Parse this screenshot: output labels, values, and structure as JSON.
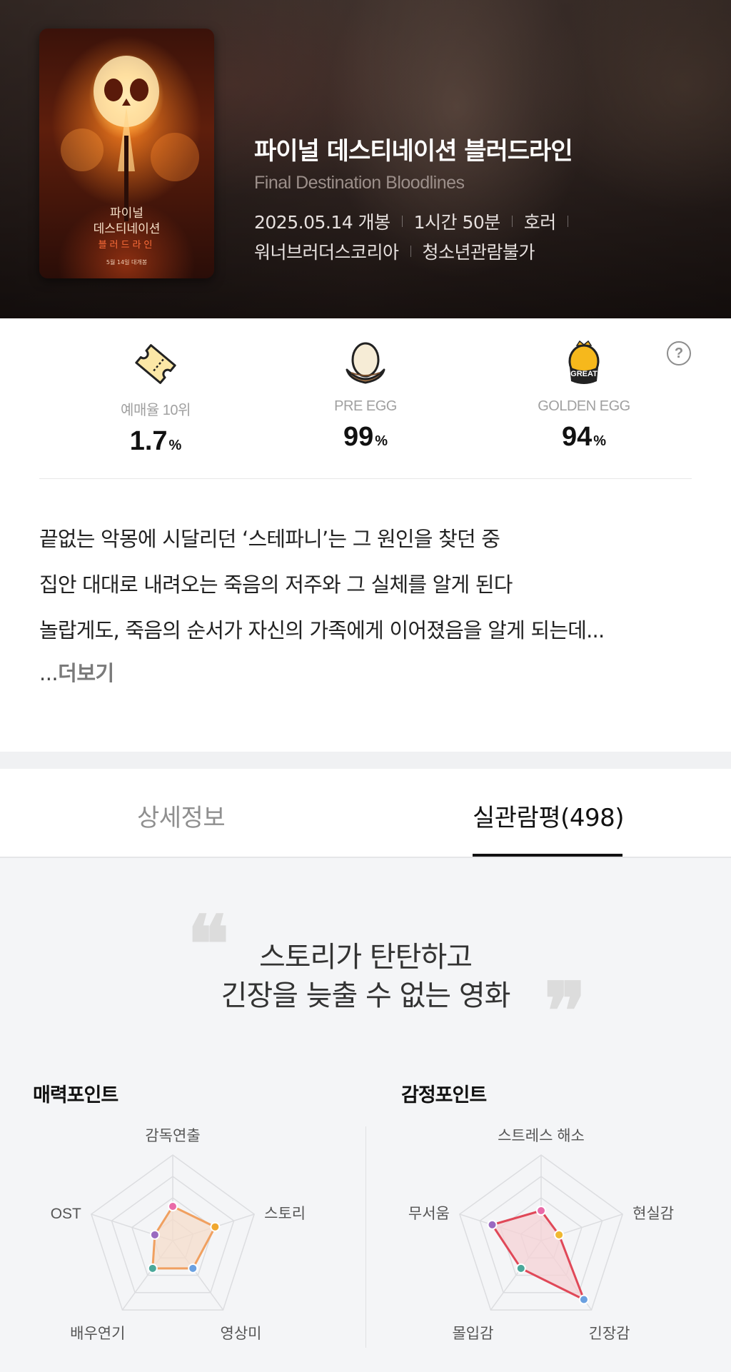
{
  "movie": {
    "title": "파이널 데스티네이션 블러드라인",
    "original_title": "Final Destination Bloodlines",
    "release": "2025.05.14 개봉",
    "runtime": "1시간 50분",
    "genre": "호러",
    "distributor": "워너브러더스코리아",
    "rating": "청소년관람불가",
    "poster": {
      "title_line1": "파이널",
      "title_line2": "데스티네이션",
      "title_line3": "블러드라인",
      "date_text": "5월 14일 대개봉"
    }
  },
  "stats": {
    "booking": {
      "label": "예매율 10위",
      "value": "1.7",
      "unit": "%",
      "icon": "ticket-icon"
    },
    "pre_egg": {
      "label": "PRE EGG",
      "value": "99",
      "unit": "%",
      "icon": "egg-nest-icon"
    },
    "golden_egg": {
      "label": "GOLDEN EGG",
      "value": "94",
      "unit": "%",
      "icon": "golden-egg-great-icon",
      "badge": "GREAT"
    },
    "help": "?"
  },
  "synopsis": {
    "lines": [
      "끝없는 악몽에 시달리던 ‘스테파니’는 그 원인을 찾던 중",
      "집안 대대로 내려오는 죽음의 저주와 그 실체를 알게 된다",
      "놀랍게도, 죽음의 순서가 자신의 가족에게 이어졌음을 알게 되는데..."
    ],
    "more_prefix": "...",
    "more_label": "더보기"
  },
  "tabs": {
    "detail": "상세정보",
    "reviews": "실관람평(498)",
    "active": "reviews"
  },
  "review": {
    "headline_line1": "스토리가 탄탄하고",
    "headline_line2": "긴장을 늦출 수 없는 영화",
    "quote_open": "❝",
    "quote_close": "❞"
  },
  "chart_data": [
    {
      "type": "radar",
      "title": "매력포인트",
      "axes": [
        "감독연출",
        "스토리",
        "영상미",
        "배우연기",
        "OST"
      ],
      "values": [
        0.4,
        0.52,
        0.4,
        0.4,
        0.22
      ],
      "point_colors": [
        "#e96aa8",
        "#f0a830",
        "#6aa0e0",
        "#4aa89a",
        "#9a6ac0"
      ],
      "fill_color": "#f5dccb",
      "stroke_color": "#f0a060"
    },
    {
      "type": "radar",
      "title": "감정포인트",
      "axes": [
        "스트레스 해소",
        "현실감",
        "긴장감",
        "몰입감",
        "무서움"
      ],
      "values": [
        0.35,
        0.22,
        0.85,
        0.4,
        0.6
      ],
      "point_colors": [
        "#e96aa8",
        "#f0b830",
        "#6aa0e0",
        "#4aa89a",
        "#9a6ac0"
      ],
      "fill_color": "#f6d2d6",
      "stroke_color": "#e04858"
    }
  ]
}
